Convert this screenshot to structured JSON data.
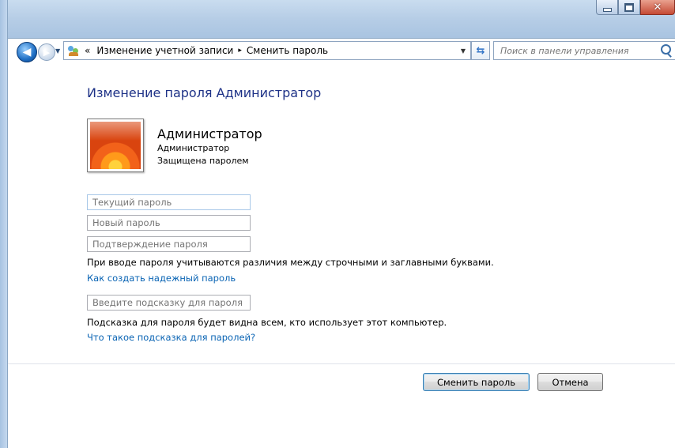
{
  "window": {
    "controls": {
      "minimize_icon": "minimize-icon",
      "maximize_icon": "maximize-icon",
      "close_glyph": "✕"
    }
  },
  "navigation": {
    "back_icon": "back-arrow-icon",
    "forward_icon": "forward-arrow-icon",
    "address": {
      "overflow_marker": "«",
      "crumbs": [
        "Изменение учетной записи",
        "Сменить пароль"
      ],
      "separator": "▸"
    },
    "search": {
      "placeholder": "Поиск в панели управления"
    }
  },
  "page": {
    "heading": "Изменение пароля Администратор",
    "user": {
      "name": "Администратор",
      "role": "Администратор",
      "status": "Защищена паролем"
    },
    "fields": {
      "current_password_placeholder": "Текущий пароль",
      "new_password_placeholder": "Новый пароль",
      "confirm_password_placeholder": "Подтверждение пароля",
      "hint_placeholder": "Введите подсказку для пароля"
    },
    "case_note": "При вводе пароля учитываются различия между строчными и заглавными буквами.",
    "strong_password_link": "Как создать надежный пароль",
    "hint_note": "Подсказка для пароля будет видна всем, кто использует этот компьютер.",
    "hint_link": "Что такое подсказка для паролей?",
    "buttons": {
      "change": "Сменить пароль",
      "cancel": "Отмена"
    }
  },
  "colors": {
    "heading": "#1e3287",
    "link": "#0a64b4",
    "titlebar": "#b6cde6"
  }
}
